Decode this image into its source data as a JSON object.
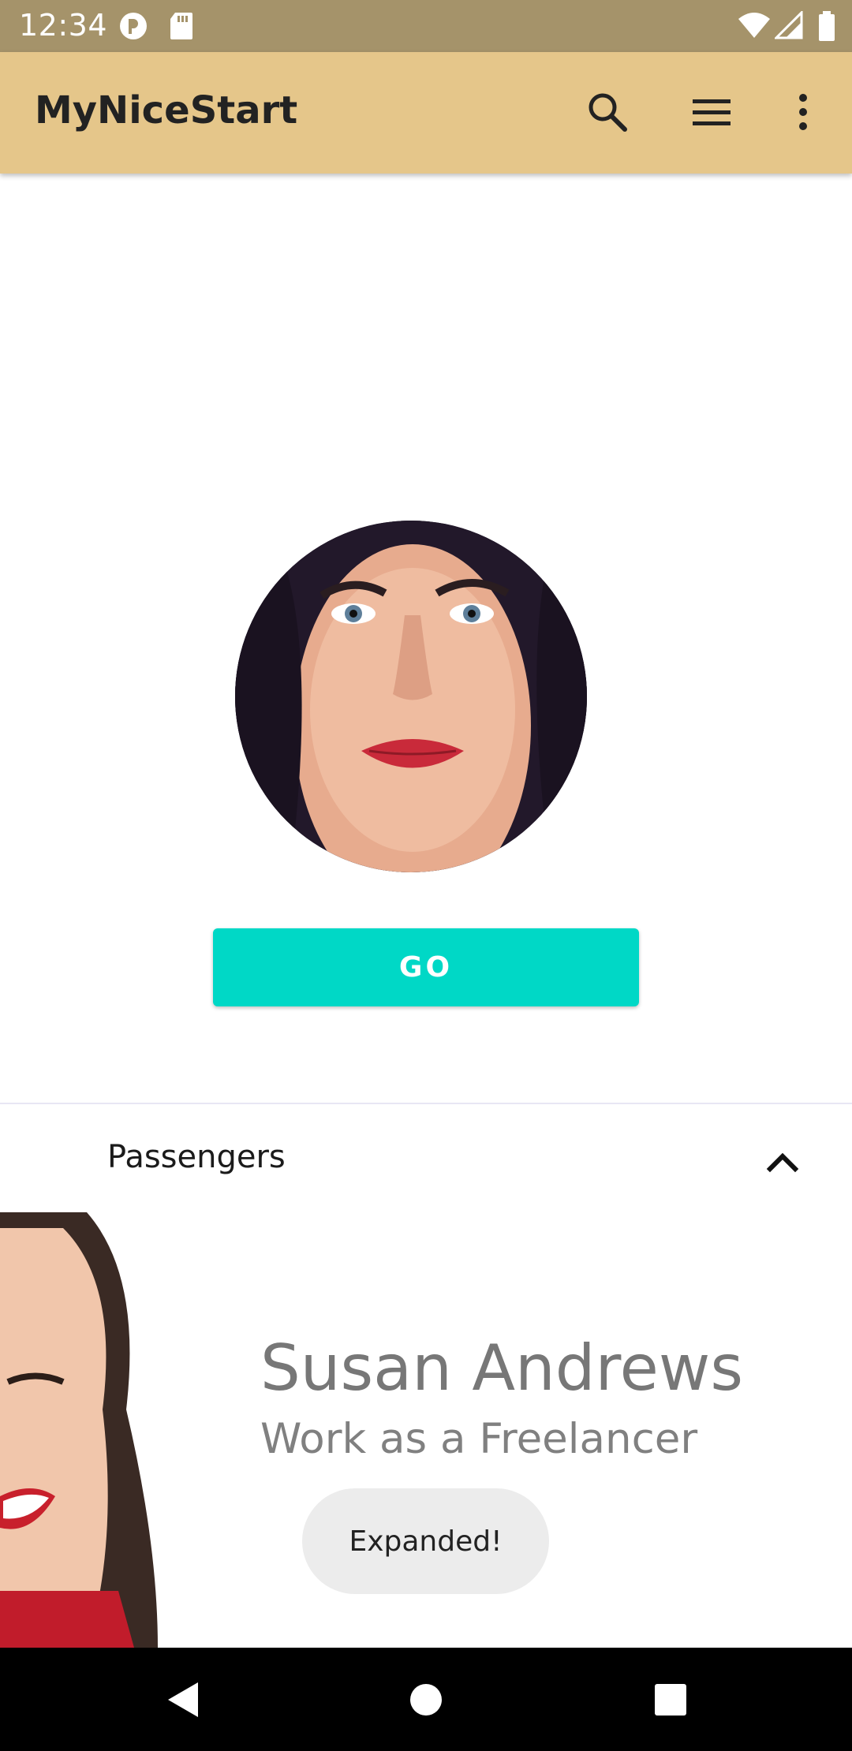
{
  "status_bar": {
    "time": "12:34",
    "icons": [
      "notification-app-icon",
      "sd-card-icon",
      "wifi-icon",
      "signal-icon",
      "battery-icon"
    ]
  },
  "toolbar": {
    "title": "MyNiceStart",
    "actions": [
      "search-icon",
      "menu-icon",
      "more-vert-icon"
    ],
    "background": "#e5c68a"
  },
  "main": {
    "go_label": "GO",
    "go_color": "#00d8c6"
  },
  "section": {
    "title": "Passengers",
    "expanded": true
  },
  "passenger": {
    "name": "Susan Andrews",
    "job": "Work as a Freelancer"
  },
  "toast": {
    "text": "Expanded!"
  },
  "navigation": [
    "back-icon",
    "home-icon",
    "recents-icon"
  ]
}
